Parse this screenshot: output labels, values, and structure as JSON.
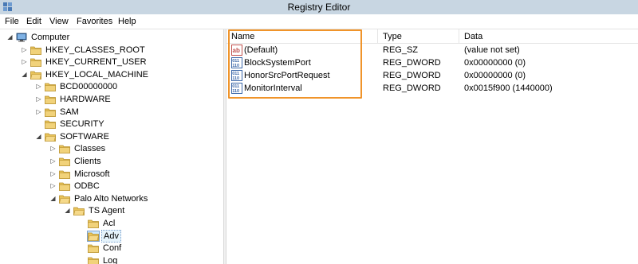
{
  "window": {
    "title": "Registry Editor"
  },
  "menu": {
    "items": [
      "File",
      "Edit",
      "View",
      "Favorites",
      "Help"
    ]
  },
  "tree": {
    "items": [
      {
        "label": "Computer",
        "expanded": true,
        "icon": "computer-icon"
      },
      {
        "label": "HKEY_CLASSES_ROOT",
        "expanded": false,
        "icon": "folder-icon"
      },
      {
        "label": "HKEY_CURRENT_USER",
        "expanded": false,
        "icon": "folder-icon"
      },
      {
        "label": "HKEY_LOCAL_MACHINE",
        "expanded": true,
        "icon": "folder-icon"
      },
      {
        "label": "BCD00000000",
        "expanded": false,
        "icon": "folder-icon"
      },
      {
        "label": "HARDWARE",
        "expanded": false,
        "icon": "folder-icon"
      },
      {
        "label": "SAM",
        "expanded": false,
        "icon": "folder-icon"
      },
      {
        "label": "SECURITY",
        "expanded": null,
        "icon": "folder-icon"
      },
      {
        "label": "SOFTWARE",
        "expanded": true,
        "icon": "folder-icon"
      },
      {
        "label": "Classes",
        "expanded": false,
        "icon": "folder-icon"
      },
      {
        "label": "Clients",
        "expanded": false,
        "icon": "folder-icon"
      },
      {
        "label": "Microsoft",
        "expanded": false,
        "icon": "folder-icon"
      },
      {
        "label": "ODBC",
        "expanded": false,
        "icon": "folder-icon"
      },
      {
        "label": "Palo Alto Networks",
        "expanded": true,
        "icon": "folder-icon"
      },
      {
        "label": "TS Agent",
        "expanded": true,
        "icon": "folder-icon"
      },
      {
        "label": "Acl",
        "expanded": null,
        "icon": "folder-icon"
      },
      {
        "label": "Adv",
        "expanded": null,
        "icon": "folder-open-icon",
        "selected": true
      },
      {
        "label": "Conf",
        "expanded": null,
        "icon": "folder-icon"
      },
      {
        "label": "Log",
        "expanded": null,
        "icon": "folder-icon"
      }
    ]
  },
  "values": {
    "columns": {
      "name": "Name",
      "type": "Type",
      "data": "Data"
    },
    "rows": [
      {
        "name": "(Default)",
        "type": "REG_SZ",
        "data": "(value not set)",
        "icon": "string-value-icon"
      },
      {
        "name": "BlockSystemPort",
        "type": "REG_DWORD",
        "data": "0x00000000 (0)",
        "icon": "binary-value-icon"
      },
      {
        "name": "HonorSrcPortRequest",
        "type": "REG_DWORD",
        "data": "0x00000000 (0)",
        "icon": "binary-value-icon"
      },
      {
        "name": "MonitorInterval",
        "type": "REG_DWORD",
        "data": "0x0015f900 (1440000)",
        "icon": "binary-value-icon"
      }
    ]
  },
  "colors": {
    "titlebar": "#c8d6e2",
    "highlight": "#f0942a",
    "folder": "#e8c35a"
  }
}
